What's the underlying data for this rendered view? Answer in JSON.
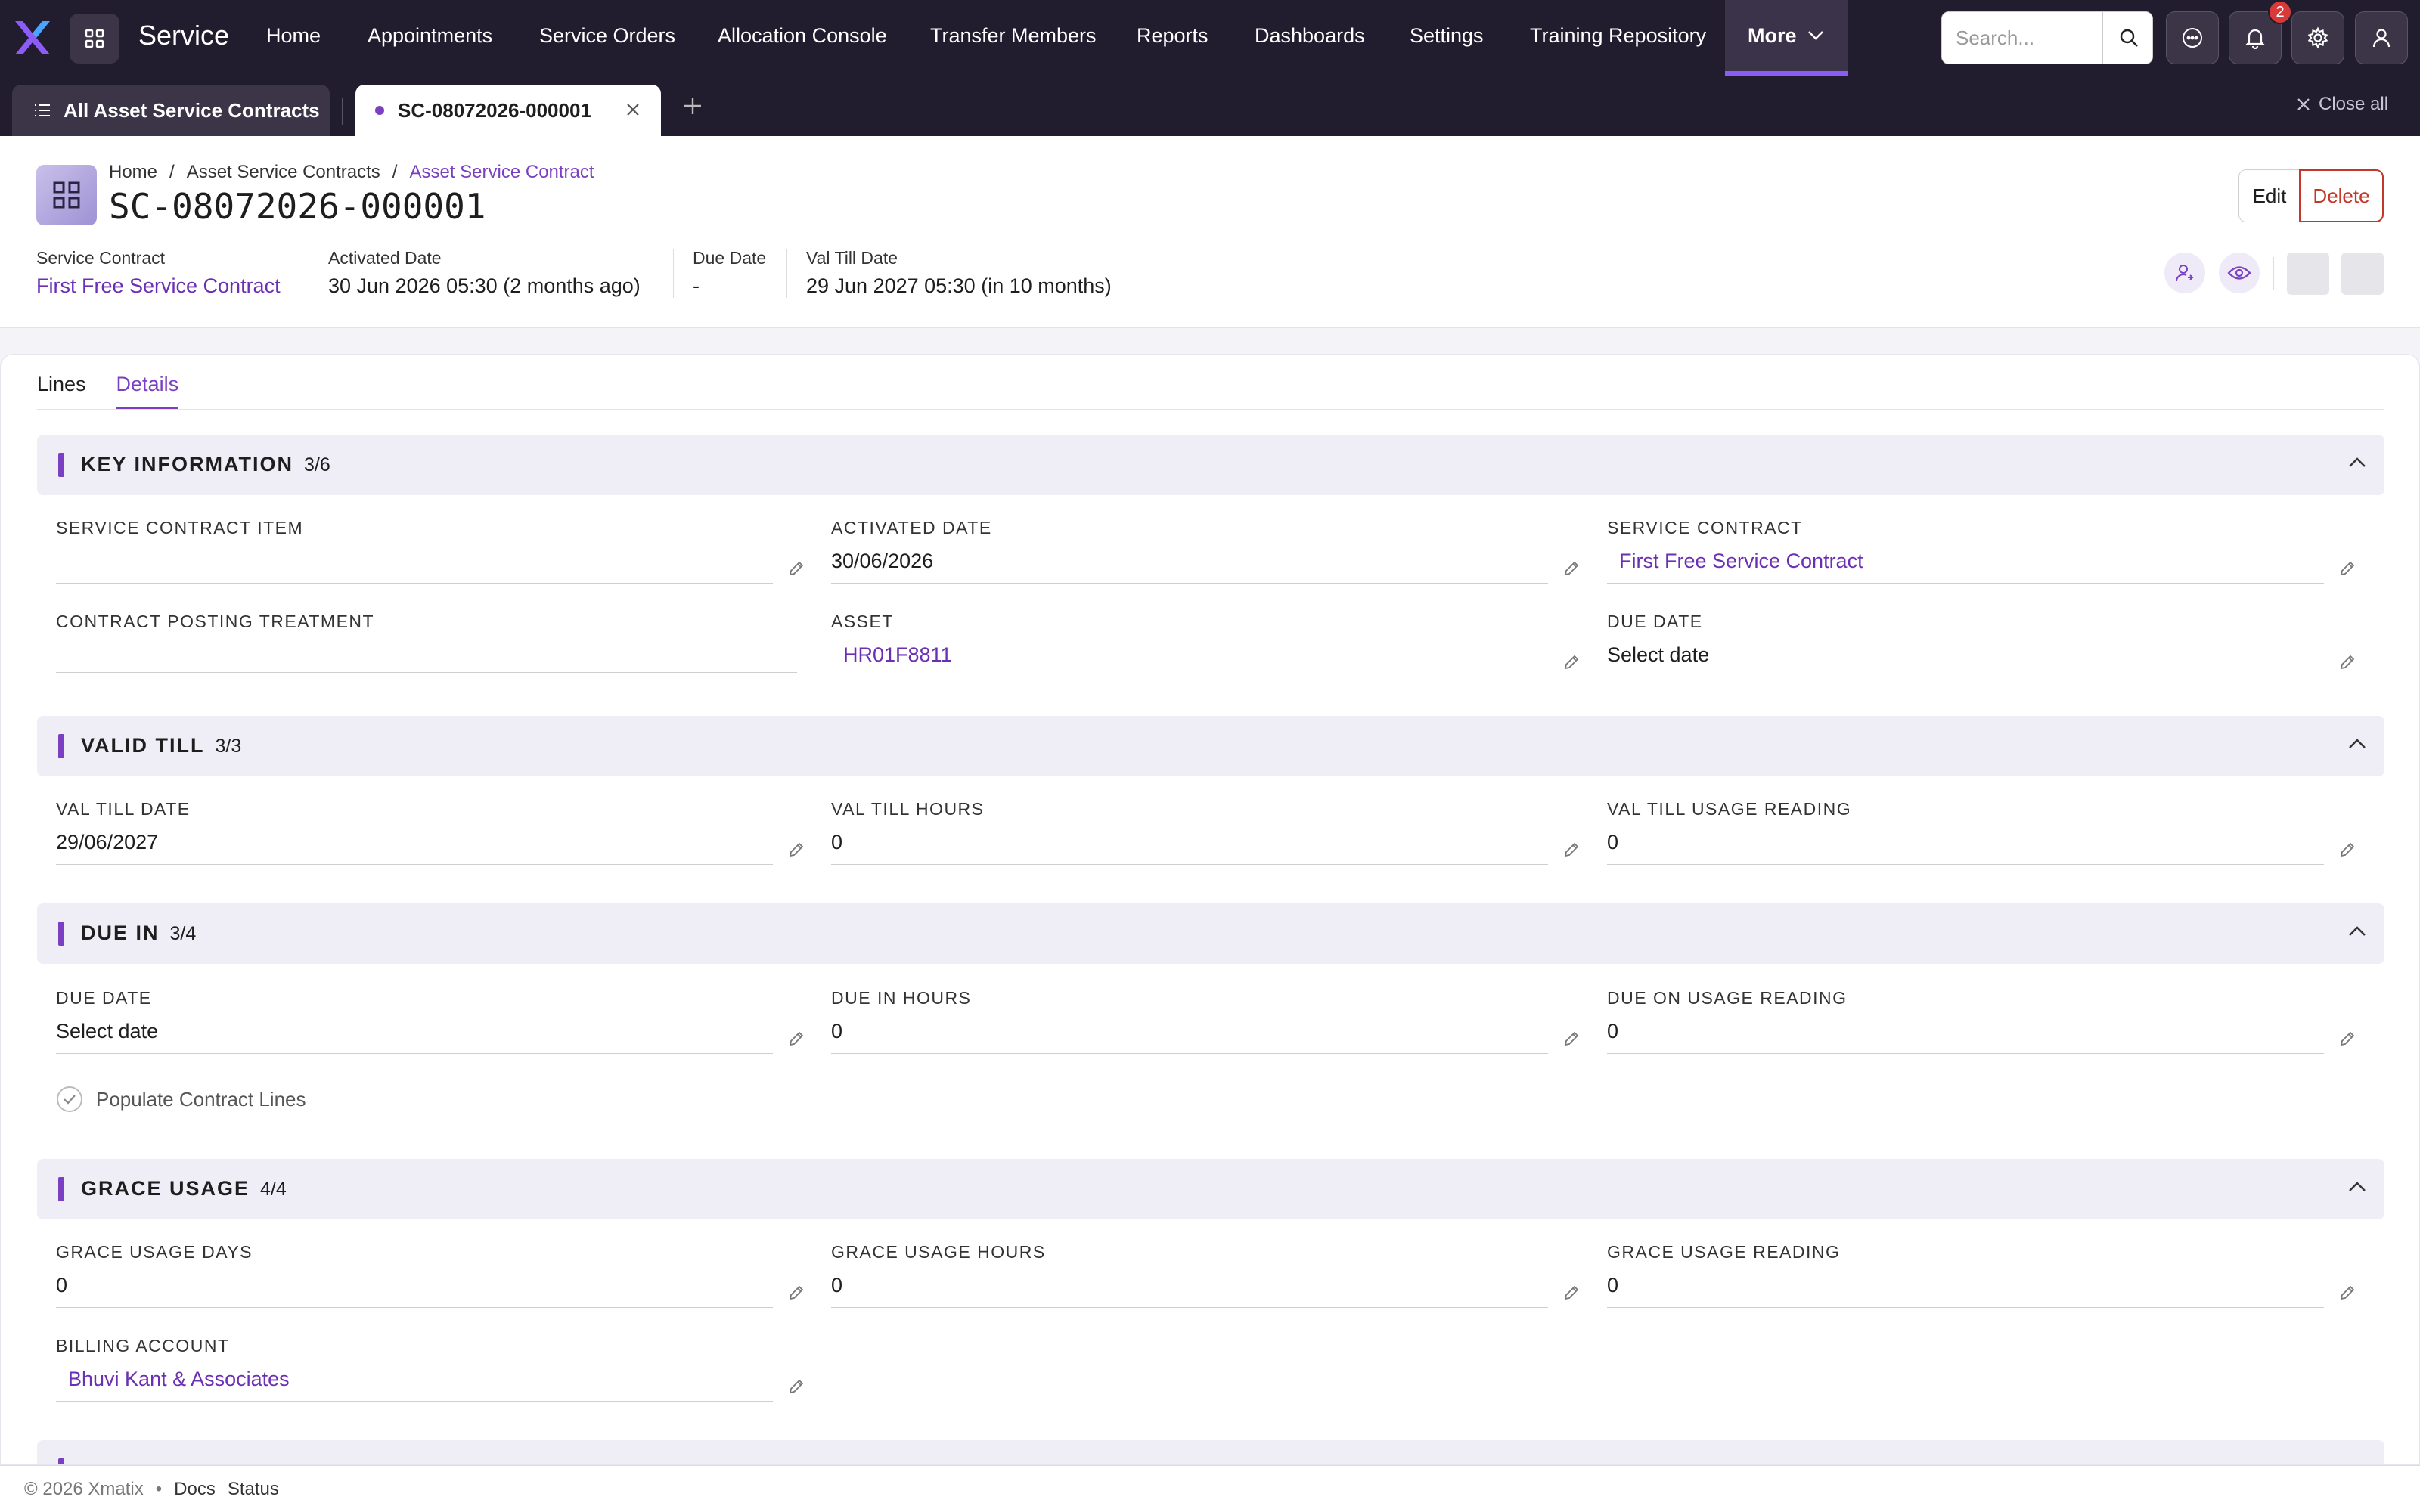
{
  "nav": {
    "app_title": "Service",
    "items": [
      "Home",
      "Appointments",
      "Service Orders",
      "Allocation Console",
      "Transfer Members",
      "Reports",
      "Dashboards",
      "Settings",
      "Training Repository"
    ],
    "more_label": "More",
    "search_placeholder": "Search...",
    "notification_count": "2"
  },
  "tabs": {
    "list_tab": "All Asset Service Contracts",
    "record_tab": "SC-08072026-000001",
    "close_all": "Close all"
  },
  "header": {
    "breadcrumb": [
      "Home",
      "Asset Service Contracts",
      "Asset Service Contract"
    ],
    "title": "SC-08072026-000001",
    "edit_label": "Edit",
    "delete_label": "Delete",
    "meta": [
      {
        "label": "Service Contract",
        "value": "First Free Service Contract"
      },
      {
        "label": "Activated Date",
        "value": "30 Jun 2026 05:30 (2 months ago)"
      },
      {
        "label": "Due Date",
        "value": "-"
      },
      {
        "label": "Val Till Date",
        "value": "29 Jun 2027 05:30 (in 10 months)"
      }
    ]
  },
  "detail_tabs": [
    "Lines",
    "Details"
  ],
  "sections": {
    "key_info": {
      "title": "KEY INFORMATION",
      "count": "3/6",
      "fields": [
        {
          "label": "SERVICE CONTRACT ITEM",
          "value": ""
        },
        {
          "label": "ACTIVATED DATE",
          "value": "30/06/2026"
        },
        {
          "label": "SERVICE CONTRACT",
          "value": "First Free Service Contract"
        },
        {
          "label": "CONTRACT POSTING TREATMENT",
          "value": ""
        },
        {
          "label": "ASSET",
          "value": "HR01F8811"
        },
        {
          "label": "DUE DATE",
          "value": "Select date"
        }
      ]
    },
    "valid_till": {
      "title": "VALID TILL",
      "count": "3/3",
      "fields": [
        {
          "label": "VAL TILL DATE",
          "value": "29/06/2027"
        },
        {
          "label": "VAL TILL HOURS",
          "value": "0"
        },
        {
          "label": "VAL TILL USAGE READING",
          "value": "0"
        }
      ]
    },
    "due_in": {
      "title": "DUE IN",
      "count": "3/4",
      "fields": [
        {
          "label": "DUE DATE",
          "value": "Select date"
        },
        {
          "label": "DUE IN HOURS",
          "value": "0"
        },
        {
          "label": "DUE ON USAGE READING",
          "value": "0"
        }
      ],
      "checkbox_label": "Populate Contract Lines"
    },
    "grace_usage": {
      "title": "GRACE USAGE",
      "count": "4/4",
      "fields": [
        {
          "label": "GRACE USAGE DAYS",
          "value": "0"
        },
        {
          "label": "GRACE USAGE HOURS",
          "value": "0"
        },
        {
          "label": "GRACE USAGE READING",
          "value": "0"
        },
        {
          "label": "BILLING ACCOUNT",
          "value": "Bhuvi Kant & Associates"
        }
      ]
    }
  },
  "footer": {
    "copyright": "© 2026 Xmatix",
    "separator": "•",
    "docs": "Docs",
    "status": "Status"
  },
  "colors": {
    "accent": "#7a3fc2",
    "nav_bg": "#221d2e",
    "danger": "#c0392b"
  }
}
